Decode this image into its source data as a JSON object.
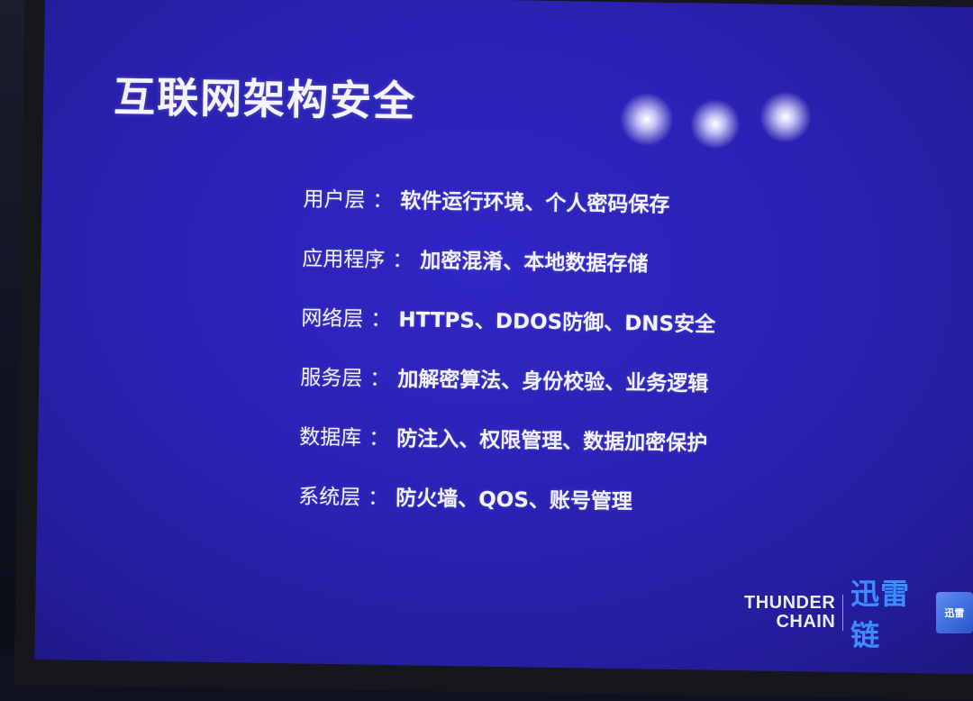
{
  "slide": {
    "title": "互联网架构安全",
    "separator": "：",
    "items": [
      {
        "label": "用户层",
        "content": "软件运行环境、个人密码保存"
      },
      {
        "label": "应用程序",
        "content": "加密混淆、本地数据存储"
      },
      {
        "label": "网络层",
        "content": "HTTPS、DDOS防御、DNS安全"
      },
      {
        "label": "服务层",
        "content": "加解密算法、身份校验、业务逻辑"
      },
      {
        "label": "数据库",
        "content": "防注入、权限管理、数据加密保护"
      },
      {
        "label": "系统层",
        "content": "防火墙、QOS、账号管理"
      }
    ]
  },
  "logo": {
    "line1": "THUNDER",
    "line2": "CHAIN",
    "cn_text": "迅雷链",
    "badge_text": "迅雷",
    "color": "#3d8bff"
  },
  "colors": {
    "slide_background": "#2a22b3",
    "text": "#f2f2ff"
  }
}
